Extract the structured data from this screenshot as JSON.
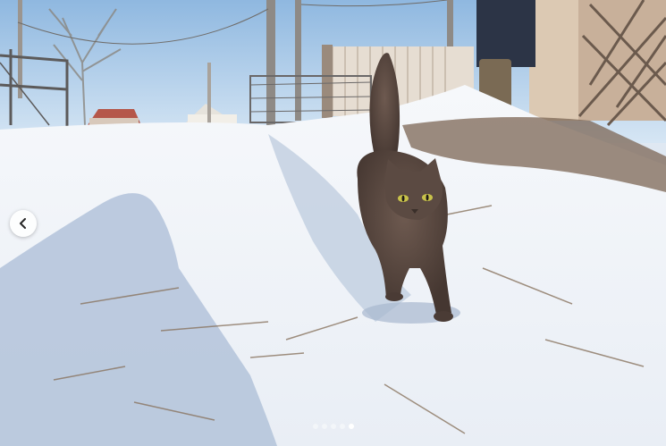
{
  "carousel": {
    "total_slides": 5,
    "active_index": 4,
    "prev_icon": "chevron-left-icon",
    "dot_color": "#ffffff",
    "accent_color": "#ffffff"
  },
  "photo": {
    "colors": {
      "sky": "#a9c8e6",
      "snow": "#f1f4f8",
      "shadow": "#b8c6da",
      "cat": "#5b4a42",
      "cat_eyes": "#c8c24a",
      "fence": "#e6ddd2"
    }
  }
}
